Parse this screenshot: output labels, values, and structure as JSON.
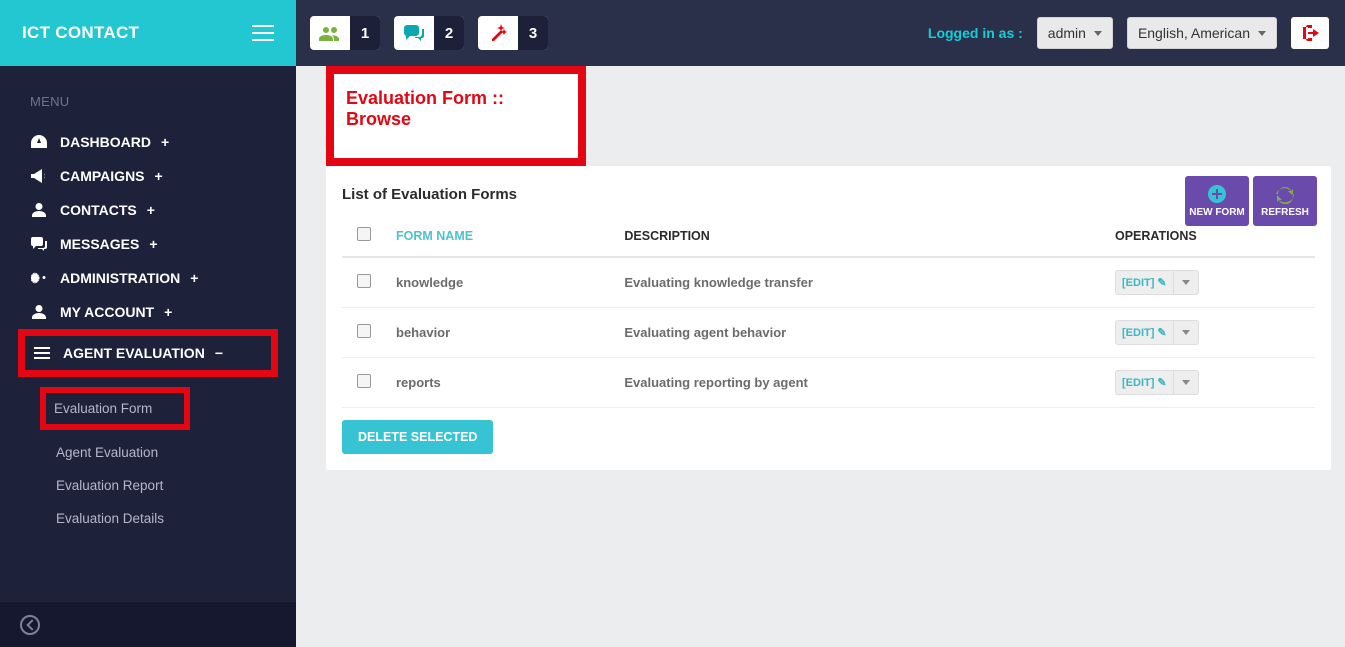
{
  "brand": "ICT CONTACT",
  "menu_label": "MENU",
  "nav": {
    "dashboard": "DASHBOARD",
    "campaigns": "CAMPAIGNS",
    "contacts": "CONTACTS",
    "messages": "MESSAGES",
    "administration": "ADMINISTRATION",
    "my_account": "MY ACCOUNT",
    "agent_evaluation": "AGENT EVALUATION"
  },
  "subnav": {
    "evaluation_form": "Evaluation Form",
    "agent_evaluation": "Agent Evaluation",
    "evaluation_report": "Evaluation Report",
    "evaluation_details": "Evaluation Details"
  },
  "topbar": {
    "step1": "1",
    "step2": "2",
    "step3": "3",
    "logged_label": "Logged in as :",
    "user": "admin",
    "language": "English, American"
  },
  "page": {
    "heading": "Evaluation Form :: Browse",
    "list_title": "List of Evaluation Forms",
    "new_form": "NEW FORM",
    "refresh": "REFRESH",
    "delete_selected": "DELETE SELECTED"
  },
  "columns": {
    "form_name": "FORM NAME",
    "description": "DESCRIPTION",
    "operations": "OPERATIONS"
  },
  "rows": [
    {
      "name": "knowledge",
      "desc": "Evaluating knowledge transfer"
    },
    {
      "name": "behavior",
      "desc": "Evaluating agent behavior"
    },
    {
      "name": "reports",
      "desc": "Evaluating reporting by agent"
    }
  ],
  "ops": {
    "edit": "[EDIT]"
  }
}
